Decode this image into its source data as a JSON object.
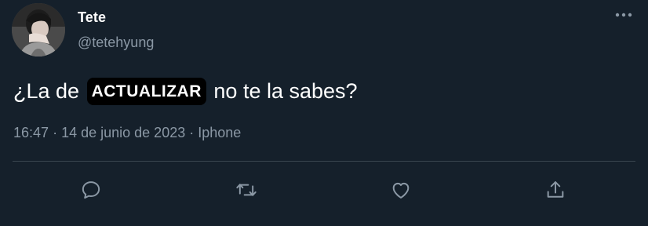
{
  "author": {
    "display_name": "Tete",
    "handle": "@tetehyung",
    "avatar_icon": "profile-photo"
  },
  "tweet": {
    "text_before": "¿La de",
    "badge": "ACTUALIZAR",
    "text_after": "no te la sabes?",
    "time": "16:47",
    "date": "14 de junio de 2023",
    "source": "Iphone",
    "separator": "·"
  },
  "actions": [
    {
      "name": "reply",
      "icon": "comment-icon"
    },
    {
      "name": "retweet",
      "icon": "retweet-icon"
    },
    {
      "name": "like",
      "icon": "heart-icon"
    },
    {
      "name": "share",
      "icon": "share-icon"
    }
  ],
  "colors": {
    "background": "#15202b",
    "secondary_text": "#8b98a5",
    "divider": "#38444d",
    "badge_background": "#000000"
  }
}
